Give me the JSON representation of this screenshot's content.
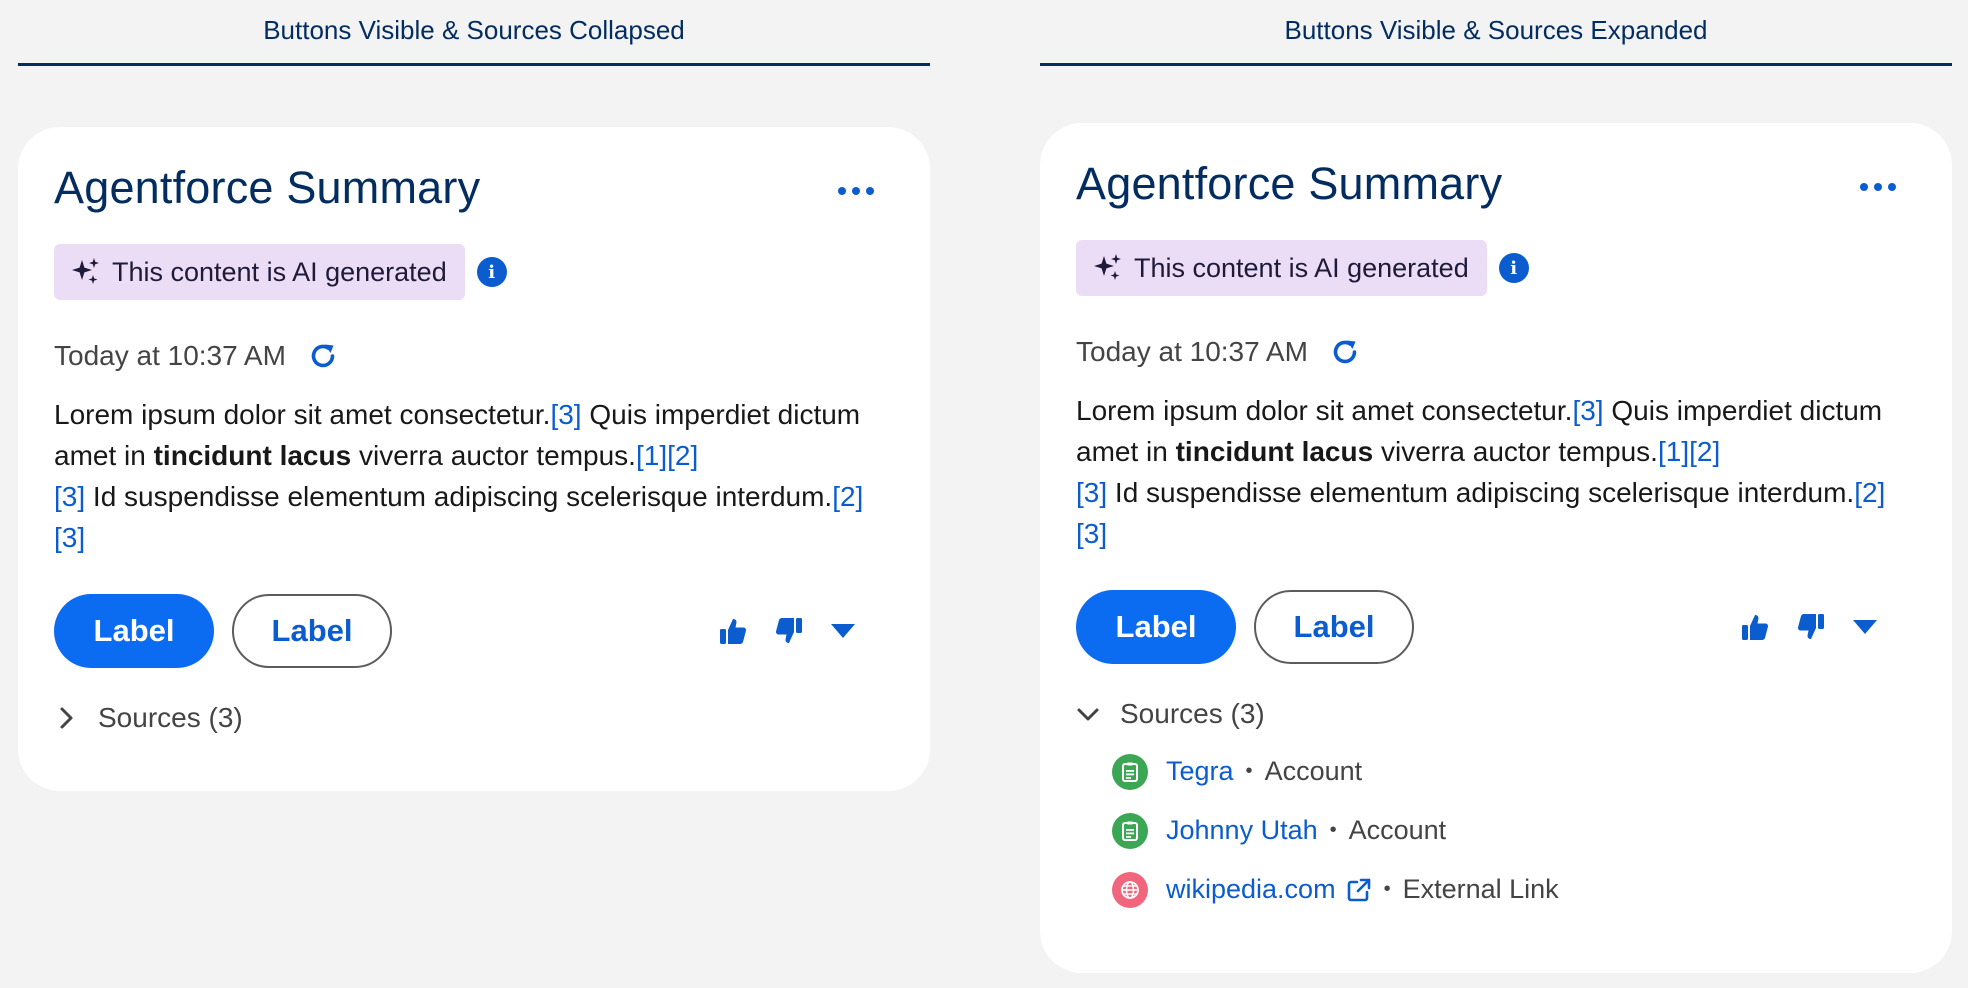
{
  "colors": {
    "brand_blue": "#0b5cce",
    "primary_button": "#0b6cf2",
    "heading_navy": "#032d60",
    "ai_badge_bg": "#ecddf7",
    "source_green": "#3ba755",
    "source_pink": "#f0677d"
  },
  "panels": [
    {
      "heading": "Buttons Visible & Sources Collapsed",
      "card": {
        "title": "Agentforce Summary",
        "more_icon": "ellipsis-icon",
        "ai_badge": "This content is AI generated",
        "timestamp": "Today at 10:37 AM",
        "summary": {
          "s1": "Lorem ipsum dolor sit amet consectetur.",
          "c1": "[3]",
          "s2": " Quis imperdiet dictum amet in ",
          "bold": "tincidunt lacus",
          "s3": " viverra auctor tempus.",
          "c2": "[1]",
          "c3": "[2]",
          "c4": "[3]",
          "s4": " Id suspendisse elementum adipiscing scelerisque interdum.",
          "c5": "[2]",
          "c6": "[3]"
        },
        "buttons": {
          "primary": "Label",
          "secondary": "Label"
        },
        "sources": {
          "label": "Sources (3)",
          "expanded": false
        }
      }
    },
    {
      "heading": "Buttons Visible & Sources Expanded",
      "card": {
        "title": "Agentforce Summary",
        "more_icon": "ellipsis-icon",
        "ai_badge": "This content is AI generated",
        "timestamp": "Today at 10:37 AM",
        "summary": {
          "s1": "Lorem ipsum dolor sit amet consectetur.",
          "c1": "[3]",
          "s2": " Quis imperdiet dictum amet in ",
          "bold": "tincidunt lacus",
          "s3": " viverra auctor tempus.",
          "c2": "[1]",
          "c3": "[2]",
          "c4": "[3]",
          "s4": " Id suspendisse elementum adipiscing scelerisque interdum.",
          "c5": "[2]",
          "c6": "[3]"
        },
        "buttons": {
          "primary": "Label",
          "secondary": "Label"
        },
        "sources": {
          "label": "Sources (3)",
          "expanded": true,
          "items": [
            {
              "name": "Tegra",
              "type": "Account",
              "icon": "account-icon"
            },
            {
              "name": "Johnny Utah",
              "type": "Account",
              "icon": "account-icon"
            },
            {
              "name": "wikipedia.com",
              "type": "External Link",
              "icon": "globe-icon"
            }
          ]
        }
      }
    }
  ]
}
